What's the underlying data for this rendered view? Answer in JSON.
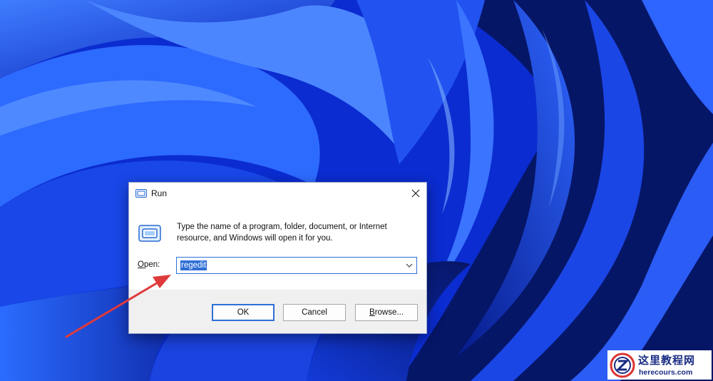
{
  "dialog": {
    "title": "Run",
    "description": "Type the name of a program, folder, document, or Internet resource, and Windows will open it for you.",
    "open_label_prefix": "",
    "open_label_mnemonic": "O",
    "open_label_rest": "pen:",
    "input_value": "regedit",
    "buttons": {
      "ok": "OK",
      "cancel": "Cancel",
      "browse_mnemonic": "B",
      "browse_rest": "rowse..."
    }
  },
  "icons": {
    "title": "run-app-icon",
    "body": "run-app-icon",
    "close": "close-icon",
    "dropdown": "chevron-down-icon"
  },
  "watermark": {
    "title": "这里教程网",
    "url": "herecours.com"
  },
  "colors": {
    "wallpaper": "#0a2bd6",
    "selection": "#2f6fd6",
    "arrow": "#e0393b",
    "watermark_text": "#1a2c84"
  }
}
